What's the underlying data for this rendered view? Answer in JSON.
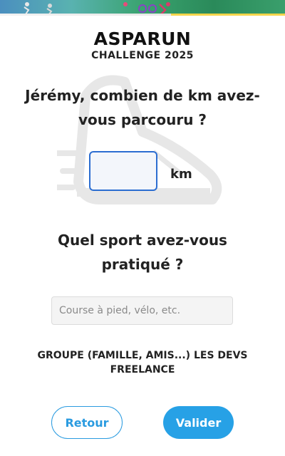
{
  "header": {
    "title": "ASPARUN",
    "subtitle": "CHALLENGE 2025"
  },
  "distance": {
    "question": "Jérémy, combien de km avez-vous parcouru ?",
    "value": "",
    "unit": "km"
  },
  "sport": {
    "question": "Quel sport avez-vous pratiqué ?",
    "value": "",
    "placeholder": "Course à pied, vélo, etc."
  },
  "group": {
    "label": "GROUPE (FAMILLE, AMIS...) LES DEVS FREELANCE"
  },
  "actions": {
    "back_label": "Retour",
    "submit_label": "Valider"
  },
  "icons": {
    "watermark": "running-shoe-icon"
  },
  "colors": {
    "accent": "#27a1e6",
    "input_border": "#2b6dd1",
    "banner_start": "#4b8fbf",
    "banner_end": "#3a9f6c"
  }
}
